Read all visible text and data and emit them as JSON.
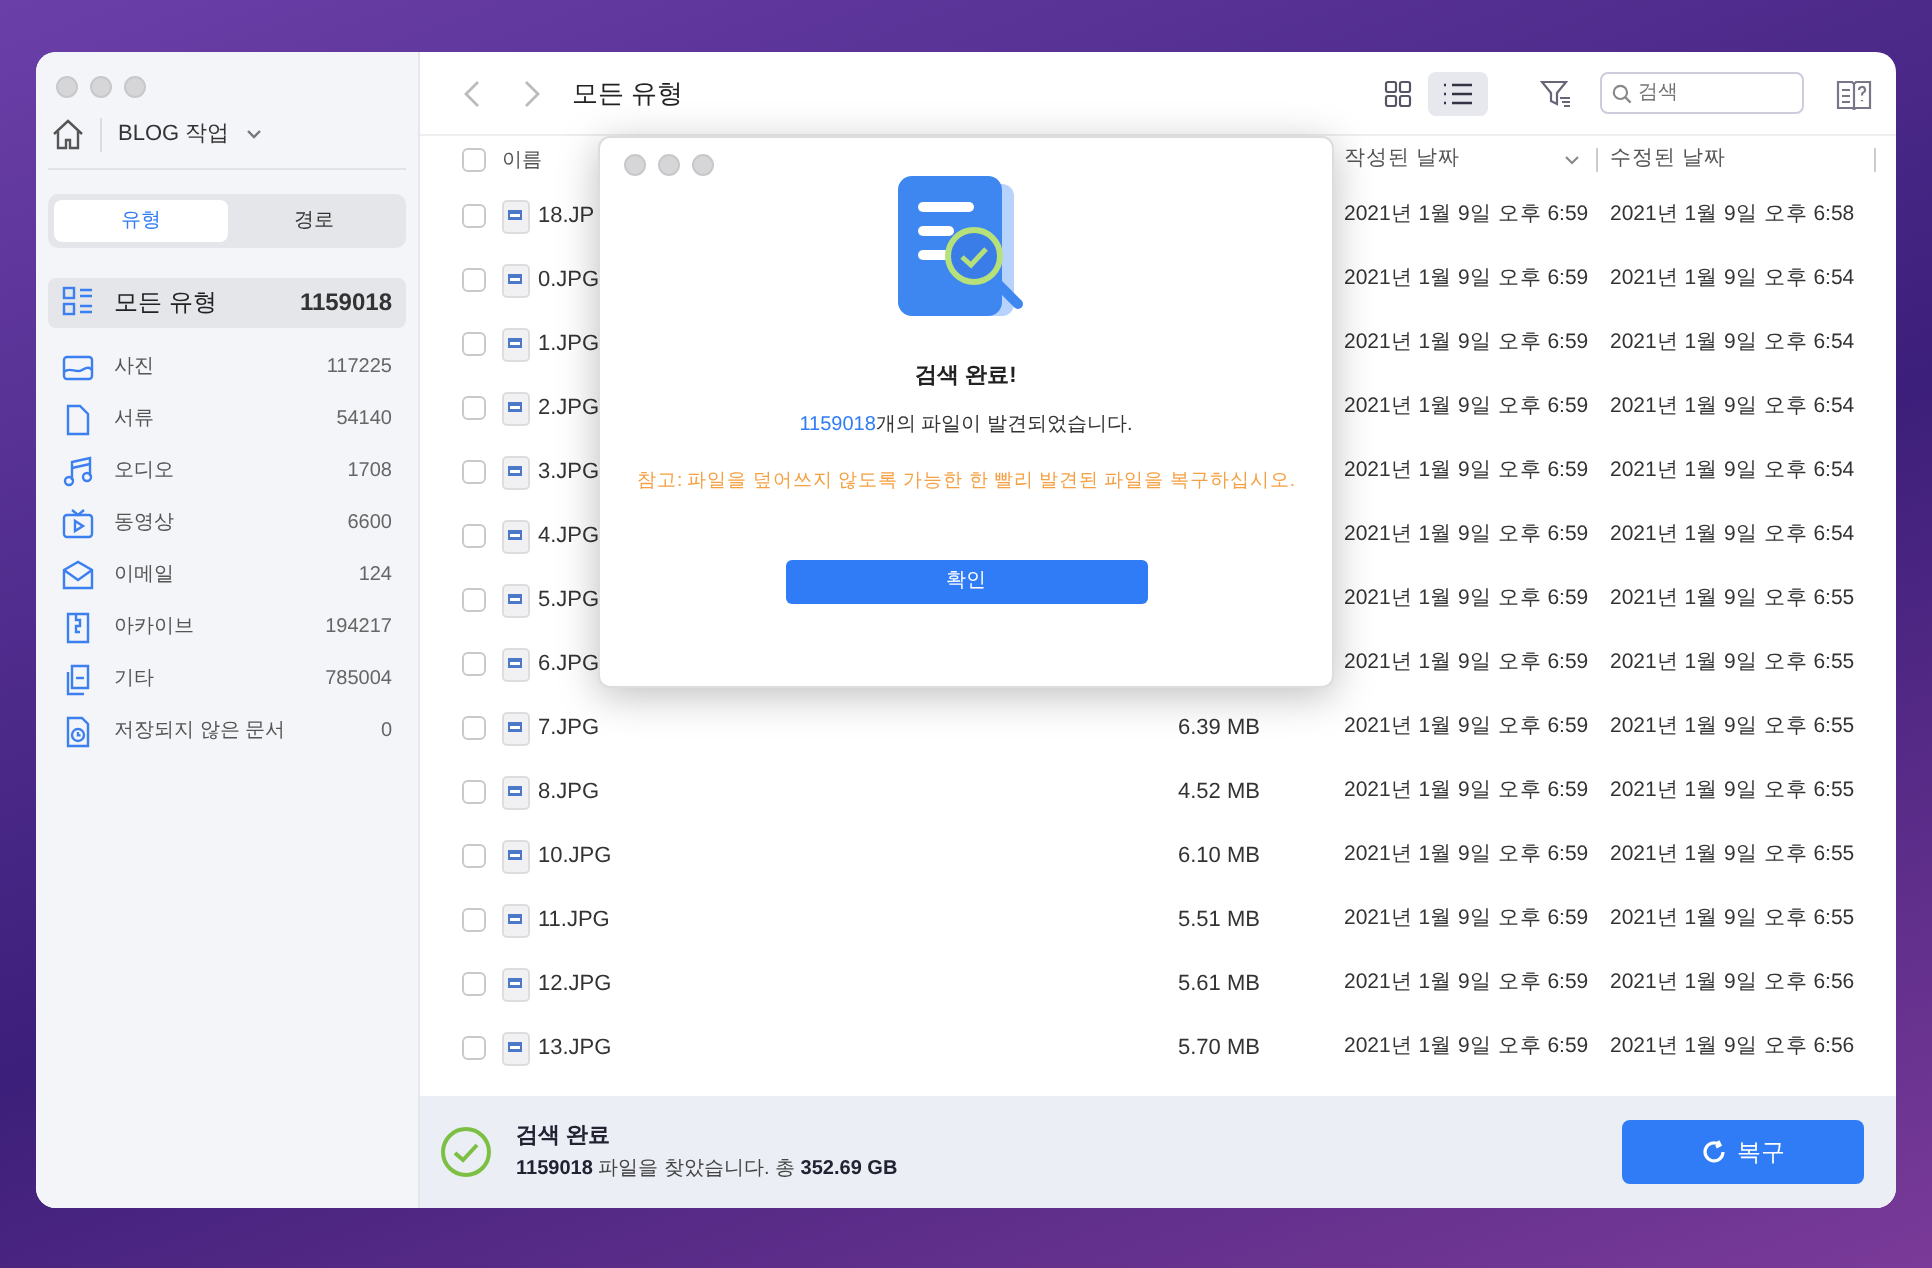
{
  "sidebar": {
    "location": "BLOG 작업",
    "tabs": [
      {
        "label": "유형",
        "selected": true
      },
      {
        "label": "경로",
        "selected": false
      }
    ],
    "categories": [
      {
        "kind": "all",
        "label": "모든 유형",
        "count": "1159018",
        "selected": true
      },
      {
        "kind": "photo",
        "label": "사진",
        "count": "117225",
        "selected": false
      },
      {
        "kind": "document",
        "label": "서류",
        "count": "54140",
        "selected": false
      },
      {
        "kind": "audio",
        "label": "오디오",
        "count": "1708",
        "selected": false
      },
      {
        "kind": "video",
        "label": "동영상",
        "count": "6600",
        "selected": false
      },
      {
        "kind": "email",
        "label": "이메일",
        "count": "124",
        "selected": false
      },
      {
        "kind": "archive",
        "label": "아카이브",
        "count": "194217",
        "selected": false
      },
      {
        "kind": "other",
        "label": "기타",
        "count": "785004",
        "selected": false
      },
      {
        "kind": "unsaved",
        "label": "저장되지 않은 문서",
        "count": "0",
        "selected": false
      }
    ]
  },
  "toolbar": {
    "title": "모든 유형",
    "view_buttons": [
      {
        "kind": "grid",
        "selected": false
      },
      {
        "kind": "list",
        "selected": true
      }
    ],
    "search": {
      "placeholder": "검색"
    }
  },
  "table": {
    "select_all": {
      "checked": false
    },
    "columns": [
      "이름",
      "작성된 날짜",
      "수정된 날짜"
    ],
    "rows": [
      {
        "name": "18.JP",
        "created": "2021년 1월 9일 오후 6:59",
        "modified": "2021년 1월 9일 오후 6:58",
        "checked": false
      },
      {
        "name": "0.JPG",
        "created": "2021년 1월 9일 오후 6:59",
        "modified": "2021년 1월 9일 오후 6:54",
        "checked": false
      },
      {
        "name": "1.JPG",
        "created": "2021년 1월 9일 오후 6:59",
        "modified": "2021년 1월 9일 오후 6:54",
        "checked": false
      },
      {
        "name": "2.JPG",
        "created": "2021년 1월 9일 오후 6:59",
        "modified": "2021년 1월 9일 오후 6:54",
        "checked": false
      },
      {
        "name": "3.JPG",
        "created": "2021년 1월 9일 오후 6:59",
        "modified": "2021년 1월 9일 오후 6:54",
        "checked": false
      },
      {
        "name": "4.JPG",
        "created": "2021년 1월 9일 오후 6:59",
        "modified": "2021년 1월 9일 오후 6:54",
        "checked": false
      },
      {
        "name": "5.JPG",
        "created": "2021년 1월 9일 오후 6:59",
        "modified": "2021년 1월 9일 오후 6:55",
        "checked": false
      },
      {
        "name": "6.JPG",
        "created": "2021년 1월 9일 오후 6:59",
        "modified": "2021년 1월 9일 오후 6:55",
        "checked": false
      },
      {
        "name": "7.JPG",
        "size": "6.39 MB",
        "created": "2021년 1월 9일 오후 6:59",
        "modified": "2021년 1월 9일 오후 6:55",
        "checked": false
      },
      {
        "name": "8.JPG",
        "size": "4.52 MB",
        "created": "2021년 1월 9일 오후 6:59",
        "modified": "2021년 1월 9일 오후 6:55",
        "checked": false
      },
      {
        "name": "10.JPG",
        "size": "6.10 MB",
        "created": "2021년 1월 9일 오후 6:59",
        "modified": "2021년 1월 9일 오후 6:55",
        "checked": false
      },
      {
        "name": "11.JPG",
        "size": "5.51 MB",
        "created": "2021년 1월 9일 오후 6:59",
        "modified": "2021년 1월 9일 오후 6:55",
        "checked": false
      },
      {
        "name": "12.JPG",
        "size": "5.61 MB",
        "created": "2021년 1월 9일 오후 6:59",
        "modified": "2021년 1월 9일 오후 6:56",
        "checked": false
      },
      {
        "name": "13.JPG",
        "size": "5.70 MB",
        "created": "2021년 1월 9일 오후 6:59",
        "modified": "2021년 1월 9일 오후 6:56",
        "checked": false
      }
    ]
  },
  "status_bar": {
    "title": "검색 완료",
    "summary": "**1159018** 파일을 찾았습니다. 총 **352.69 GB**",
    "button": "복구"
  },
  "dialog": {
    "title": "검색 완료!",
    "message": "1159018개의 파일이 발견되었습니다.",
    "note": "참고: 파일을 덮어쓰지 않도록 가능한 한 빨리 발견된 파일을 복구하십시오.",
    "button": "확인"
  }
}
